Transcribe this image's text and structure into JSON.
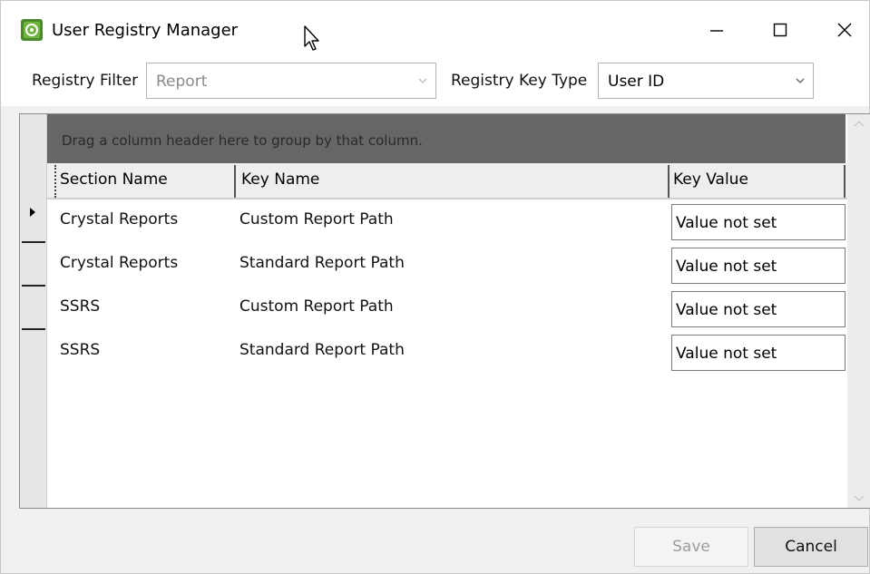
{
  "window": {
    "title": "User Registry Manager",
    "controls": {
      "minimize_icon": "minimize-icon",
      "maximize_icon": "maximize-icon",
      "close_icon": "close-icon"
    }
  },
  "filters": {
    "registry_filter_label": "Registry Filter",
    "registry_filter_value": "Report",
    "registry_key_type_label": "Registry Key Type",
    "registry_key_type_value": "User ID"
  },
  "grid": {
    "group_panel_text": "Drag a column header here to group by that column.",
    "columns": [
      "Section Name",
      "Key Name",
      "Key Value"
    ],
    "rows": [
      {
        "section": "Crystal Reports",
        "key": "Custom Report Path",
        "value": "Value not set",
        "current": true
      },
      {
        "section": "Crystal Reports",
        "key": "Standard Report Path",
        "value": "Value not set",
        "current": false
      },
      {
        "section": "SSRS",
        "key": "Custom Report Path",
        "value": "Value not set",
        "current": false
      },
      {
        "section": "SSRS",
        "key": "Standard Report Path",
        "value": "Value not set",
        "current": false
      }
    ]
  },
  "buttons": {
    "save": "Save",
    "cancel": "Cancel"
  },
  "colors": {
    "group_panel_bg": "#666666",
    "app_icon_green": "#4a8a2a"
  }
}
